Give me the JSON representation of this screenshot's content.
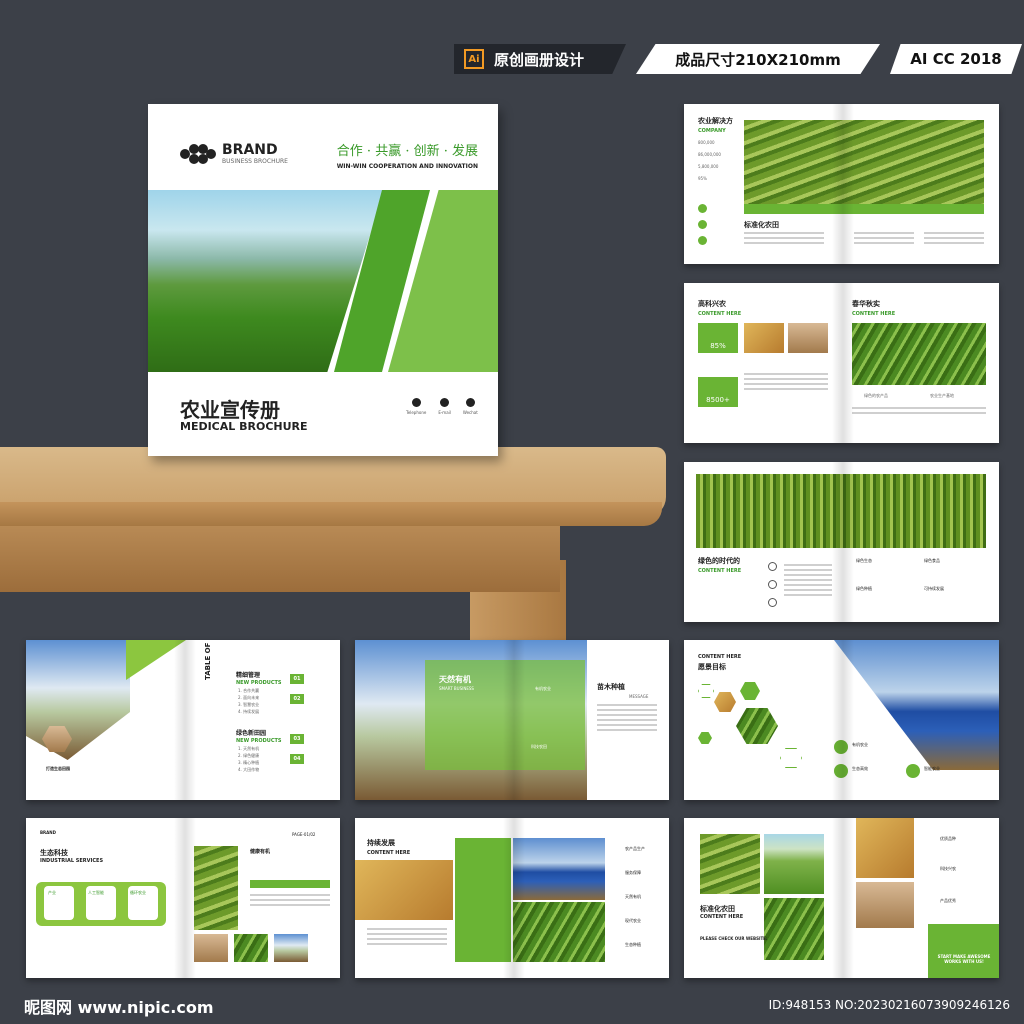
{
  "header": {
    "badge_left": "原创画册设计",
    "ai_icon": "Ai",
    "badge_size": "成品尺寸210X210mm",
    "badge_version": "AI CC 2018"
  },
  "cover": {
    "brand": "BRAND",
    "brand_sub": "BUSINESS BROCHURE",
    "slogan_cn": "合作 · 共赢 · 创新 · 发展",
    "slogan_en": "WIN-WIN COOPERATION AND INNOVATION",
    "title_cn": "农业宣传册",
    "title_en": "MEDICAL BROCHURE",
    "contacts": [
      "Telephone",
      "E-mail",
      "Wechat"
    ]
  },
  "spreads": {
    "s1": {
      "title": "农业解决方",
      "sub": "COMPANY",
      "stats": [
        "800,000",
        "86,000,000",
        "5,800,000",
        "95%"
      ],
      "caption": "标准化农田"
    },
    "s2": {
      "title_left": "高科兴农",
      "sub_left": "CONTENT HERE",
      "stat1": "85%",
      "stat2": "8500+",
      "title_right": "春华秋实",
      "sub_right": "CONTENT HERE",
      "label1": "绿色的农产品",
      "label2": "农业生产基地"
    },
    "s3": {
      "title": "绿色的时代的",
      "sub": "CONTENT HERE",
      "items": [
        "绿色生态",
        "绿色种植",
        "可持续发展",
        "绿色食品"
      ]
    },
    "s4": {
      "contents": "TABLE OF CONTENTS",
      "section1": "精细管理",
      "section1_sub": "NEW PRODUCTS",
      "list1": [
        "1. 合作共赢",
        "2. 面向未来",
        "3. 智慧农业",
        "4. 持续发展"
      ],
      "section2": "绿色新田园",
      "section2_sub": "NEW PRODUCTS",
      "list2": [
        "1. 天然有机",
        "2. 绿色健康",
        "3. 精心种植",
        "4. 大田作物"
      ],
      "nums": [
        "01",
        "02",
        "03",
        "04"
      ],
      "caption": "打造生态田园"
    },
    "s5": {
      "title": "天然有机",
      "sub": "SMART BUSINESS",
      "label1": "有机农业",
      "label2": "科技农田",
      "title_right": "苗木种植",
      "sub_right": "MESSAGE"
    },
    "s6": {
      "title_en": "CONTENT HERE",
      "title": "愿景目标",
      "items": [
        "有机农业",
        "生态高效",
        "智能农业"
      ],
      "nums": [
        "01",
        "02",
        "03"
      ]
    },
    "s7": {
      "brand": "BRAND",
      "title": "生态科技",
      "sub": "INDUSTRIAL SERVICES",
      "cards": [
        "产业",
        "人工智能",
        "循环农业"
      ],
      "page": "PAGE-01/02",
      "right_title": "健康有机"
    },
    "s8": {
      "title": "持续发展",
      "sub": "CONTENT HERE",
      "items": [
        "农产品生产",
        "服务保障",
        "天然有机",
        "现代农业",
        "生态种植"
      ]
    },
    "s9": {
      "title": "标准化农田",
      "sub": "CONTENT HERE",
      "web_label": "PLEASE CHECK OUR WEBSITE:",
      "cta": "START MAKE AWESOME WORKS WITH US!",
      "right_items": [
        "优质品种",
        "科技兴农",
        "产品优秀"
      ]
    }
  },
  "footer": {
    "site": "昵图网 www.nipic.com",
    "id": "ID:948153 NO:20230216073909246126"
  },
  "colors": {
    "background": "#3c4048",
    "accent_green": "#6ab434",
    "badge_dark": "#23262c"
  }
}
